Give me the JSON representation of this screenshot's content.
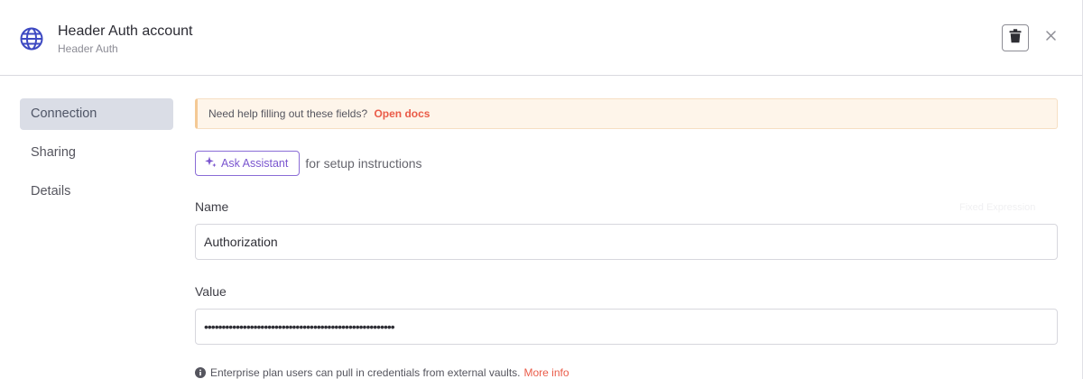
{
  "header": {
    "title": "Header Auth account",
    "subtitle": "Header Auth",
    "icon": "globe-icon",
    "delete_icon": "trash-icon",
    "close_icon": "close-icon"
  },
  "sidebar": {
    "items": [
      {
        "label": "Connection",
        "active": true
      },
      {
        "label": "Sharing",
        "active": false
      },
      {
        "label": "Details",
        "active": false
      }
    ]
  },
  "notice": {
    "text": "Need help filling out these fields?",
    "link": "Open docs"
  },
  "assistant": {
    "button_label": "Ask Assistant",
    "suffix": "for setup instructions",
    "icon": "sparkle-icon"
  },
  "fields": {
    "name": {
      "label": "Name",
      "value": "Authorization"
    },
    "value": {
      "label": "Value",
      "value": "••••••••••••••••••••••••••••••••••••••••••••••••••••••"
    }
  },
  "hint": {
    "icon": "info-icon",
    "text": "Enterprise plan users can pull in credentials from external vaults.",
    "link": "More info"
  },
  "faint_overlay": {
    "text": "Fixed  Expression"
  },
  "colors": {
    "accent": "#ea5b48",
    "assistant": "#7a55cf",
    "globe": "#3d49c2",
    "active_bg": "#dadde6",
    "notice_bg": "#fef5ea"
  }
}
